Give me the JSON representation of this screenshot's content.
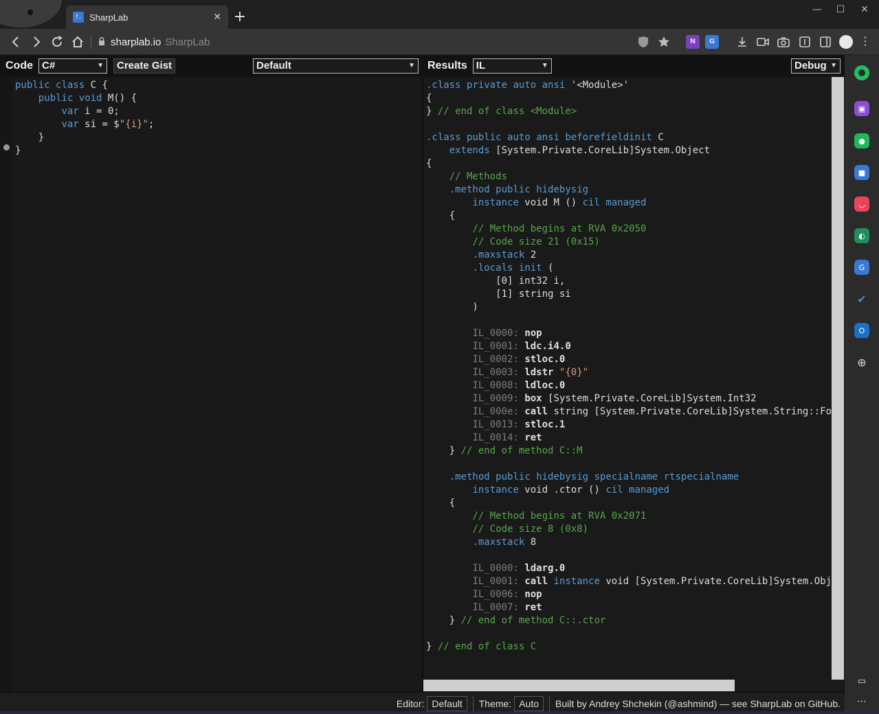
{
  "browser": {
    "tab_title": "SharpLab",
    "favicon_text": "?.",
    "tab_close": "✕",
    "new_tab": "+",
    "address_host": "sharplab.io",
    "address_title": "SharpLab",
    "window_min": "—",
    "window_max": "☐",
    "window_close": "✕"
  },
  "code_pane": {
    "label": "Code",
    "language": "C#",
    "gist_button": "Create Gist",
    "branch": "Default"
  },
  "results_pane": {
    "label": "Results",
    "output": "IL",
    "mode": "Debug"
  },
  "footer": {
    "editor_label": "Editor:",
    "editor_value": "Default",
    "theme_label": "Theme:",
    "theme_value": "Auto",
    "credit": "Built by Andrey Shchekin (@ashmind) — see SharpLab on GitHub."
  },
  "colors": {
    "keyword": "#569cd6",
    "comment": "#57a64a",
    "string": "#d69d85",
    "label": "#7d7d7d"
  },
  "csharp_code": [
    [
      [
        "kw",
        "public"
      ],
      [
        "tx",
        " "
      ],
      [
        "kw",
        "class"
      ],
      [
        "tx",
        " C {"
      ]
    ],
    [
      [
        "tx",
        "    "
      ],
      [
        "kw",
        "public"
      ],
      [
        "tx",
        " "
      ],
      [
        "kw",
        "void"
      ],
      [
        "tx",
        " M() {"
      ]
    ],
    [
      [
        "tx",
        "        "
      ],
      [
        "kw",
        "var"
      ],
      [
        "tx",
        " i = 0;"
      ]
    ],
    [
      [
        "tx",
        "        "
      ],
      [
        "kw",
        "var"
      ],
      [
        "tx",
        " si = $"
      ],
      [
        "st",
        "\"{i}\""
      ],
      [
        "tx",
        ";"
      ]
    ],
    [
      [
        "tx",
        "    }"
      ]
    ],
    [
      [
        "tx",
        "}"
      ]
    ]
  ],
  "il_code": [
    [
      [
        "kw",
        ".class"
      ],
      [
        "tx",
        " "
      ],
      [
        "kw",
        "private"
      ],
      [
        "tx",
        " "
      ],
      [
        "kw",
        "auto"
      ],
      [
        "tx",
        " "
      ],
      [
        "kw",
        "ansi"
      ],
      [
        "tx",
        " '<Module>'"
      ]
    ],
    [
      [
        "tx",
        "{"
      ]
    ],
    [
      [
        "tx",
        "} "
      ],
      [
        "cm",
        "// end of class <Module>"
      ]
    ],
    [
      [
        "tx",
        ""
      ]
    ],
    [
      [
        "kw",
        ".class"
      ],
      [
        "tx",
        " "
      ],
      [
        "kw",
        "public"
      ],
      [
        "tx",
        " "
      ],
      [
        "kw",
        "auto"
      ],
      [
        "tx",
        " "
      ],
      [
        "kw",
        "ansi"
      ],
      [
        "tx",
        " "
      ],
      [
        "kw",
        "beforefieldinit"
      ],
      [
        "tx",
        " C"
      ]
    ],
    [
      [
        "tx",
        "    "
      ],
      [
        "kw",
        "extends"
      ],
      [
        "tx",
        " [System.Private.CoreLib]System.Object"
      ]
    ],
    [
      [
        "tx",
        "{"
      ]
    ],
    [
      [
        "tx",
        "    "
      ],
      [
        "cm",
        "// Methods"
      ]
    ],
    [
      [
        "tx",
        "    "
      ],
      [
        "kw",
        ".method"
      ],
      [
        "tx",
        " "
      ],
      [
        "kw",
        "public"
      ],
      [
        "tx",
        " "
      ],
      [
        "kw",
        "hidebysig"
      ]
    ],
    [
      [
        "tx",
        "        "
      ],
      [
        "kw",
        "instance"
      ],
      [
        "tx",
        " void M () "
      ],
      [
        "kw",
        "cil"
      ],
      [
        "tx",
        " "
      ],
      [
        "kw",
        "managed"
      ]
    ],
    [
      [
        "tx",
        "    {"
      ]
    ],
    [
      [
        "tx",
        "        "
      ],
      [
        "cm",
        "// Method begins at RVA 0x2050"
      ]
    ],
    [
      [
        "tx",
        "        "
      ],
      [
        "cm",
        "// Code size 21 (0x15)"
      ]
    ],
    [
      [
        "tx",
        "        "
      ],
      [
        "kw",
        ".maxstack"
      ],
      [
        "tx",
        " 2"
      ]
    ],
    [
      [
        "tx",
        "        "
      ],
      [
        "kw",
        ".locals"
      ],
      [
        "tx",
        " "
      ],
      [
        "kw",
        "init"
      ],
      [
        "tx",
        " ("
      ]
    ],
    [
      [
        "tx",
        "            [0] int32 i,"
      ]
    ],
    [
      [
        "tx",
        "            [1] string si"
      ]
    ],
    [
      [
        "tx",
        "        )"
      ]
    ],
    [
      [
        "tx",
        ""
      ]
    ],
    [
      [
        "tx",
        "        "
      ],
      [
        "lb",
        "IL_0000:"
      ],
      [
        "tx",
        " "
      ],
      [
        "op",
        "nop"
      ]
    ],
    [
      [
        "tx",
        "        "
      ],
      [
        "lb",
        "IL_0001:"
      ],
      [
        "tx",
        " "
      ],
      [
        "op",
        "ldc.i4.0"
      ]
    ],
    [
      [
        "tx",
        "        "
      ],
      [
        "lb",
        "IL_0002:"
      ],
      [
        "tx",
        " "
      ],
      [
        "op",
        "stloc.0"
      ]
    ],
    [
      [
        "tx",
        "        "
      ],
      [
        "lb",
        "IL_0003:"
      ],
      [
        "tx",
        " "
      ],
      [
        "op",
        "ldstr"
      ],
      [
        "tx",
        " "
      ],
      [
        "st",
        "\"{0}\""
      ]
    ],
    [
      [
        "tx",
        "        "
      ],
      [
        "lb",
        "IL_0008:"
      ],
      [
        "tx",
        " "
      ],
      [
        "op",
        "ldloc.0"
      ]
    ],
    [
      [
        "tx",
        "        "
      ],
      [
        "lb",
        "IL_0009:"
      ],
      [
        "tx",
        " "
      ],
      [
        "op",
        "box"
      ],
      [
        "tx",
        " [System.Private.CoreLib]System.Int32"
      ]
    ],
    [
      [
        "tx",
        "        "
      ],
      [
        "lb",
        "IL_000e:"
      ],
      [
        "tx",
        " "
      ],
      [
        "op",
        "call"
      ],
      [
        "tx",
        " string [System.Private.CoreLib]System.String::Format(string, object)"
      ]
    ],
    [
      [
        "tx",
        "        "
      ],
      [
        "lb",
        "IL_0013:"
      ],
      [
        "tx",
        " "
      ],
      [
        "op",
        "stloc.1"
      ]
    ],
    [
      [
        "tx",
        "        "
      ],
      [
        "lb",
        "IL_0014:"
      ],
      [
        "tx",
        " "
      ],
      [
        "op",
        "ret"
      ]
    ],
    [
      [
        "tx",
        "    } "
      ],
      [
        "cm",
        "// end of method C::M"
      ]
    ],
    [
      [
        "tx",
        ""
      ]
    ],
    [
      [
        "tx",
        "    "
      ],
      [
        "kw",
        ".method"
      ],
      [
        "tx",
        " "
      ],
      [
        "kw",
        "public"
      ],
      [
        "tx",
        " "
      ],
      [
        "kw",
        "hidebysig"
      ],
      [
        "tx",
        " "
      ],
      [
        "kw",
        "specialname"
      ],
      [
        "tx",
        " "
      ],
      [
        "kw",
        "rtspecialname"
      ]
    ],
    [
      [
        "tx",
        "        "
      ],
      [
        "kw",
        "instance"
      ],
      [
        "tx",
        " void .ctor () "
      ],
      [
        "kw",
        "cil"
      ],
      [
        "tx",
        " "
      ],
      [
        "kw",
        "managed"
      ]
    ],
    [
      [
        "tx",
        "    {"
      ]
    ],
    [
      [
        "tx",
        "        "
      ],
      [
        "cm",
        "// Method begins at RVA 0x2071"
      ]
    ],
    [
      [
        "tx",
        "        "
      ],
      [
        "cm",
        "// Code size 8 (0x8)"
      ]
    ],
    [
      [
        "tx",
        "        "
      ],
      [
        "kw",
        ".maxstack"
      ],
      [
        "tx",
        " 8"
      ]
    ],
    [
      [
        "tx",
        ""
      ]
    ],
    [
      [
        "tx",
        "        "
      ],
      [
        "lb",
        "IL_0000:"
      ],
      [
        "tx",
        " "
      ],
      [
        "op",
        "ldarg.0"
      ]
    ],
    [
      [
        "tx",
        "        "
      ],
      [
        "lb",
        "IL_0001:"
      ],
      [
        "tx",
        " "
      ],
      [
        "op",
        "call"
      ],
      [
        "tx",
        " "
      ],
      [
        "kw",
        "instance"
      ],
      [
        "tx",
        " void [System.Private.CoreLib]System.Object::.ctor()"
      ]
    ],
    [
      [
        "tx",
        "        "
      ],
      [
        "lb",
        "IL_0006:"
      ],
      [
        "tx",
        " "
      ],
      [
        "op",
        "nop"
      ]
    ],
    [
      [
        "tx",
        "        "
      ],
      [
        "lb",
        "IL_0007:"
      ],
      [
        "tx",
        " "
      ],
      [
        "op",
        "ret"
      ]
    ],
    [
      [
        "tx",
        "    } "
      ],
      [
        "cm",
        "// end of method C::.ctor"
      ]
    ],
    [
      [
        "tx",
        ""
      ]
    ],
    [
      [
        "tx",
        "} "
      ],
      [
        "cm",
        "// end of class C"
      ]
    ]
  ],
  "icons": {
    "back": "back-icon",
    "forward": "forward-icon",
    "reload": "reload-icon",
    "home": "home-icon",
    "lock": "lock-icon"
  }
}
